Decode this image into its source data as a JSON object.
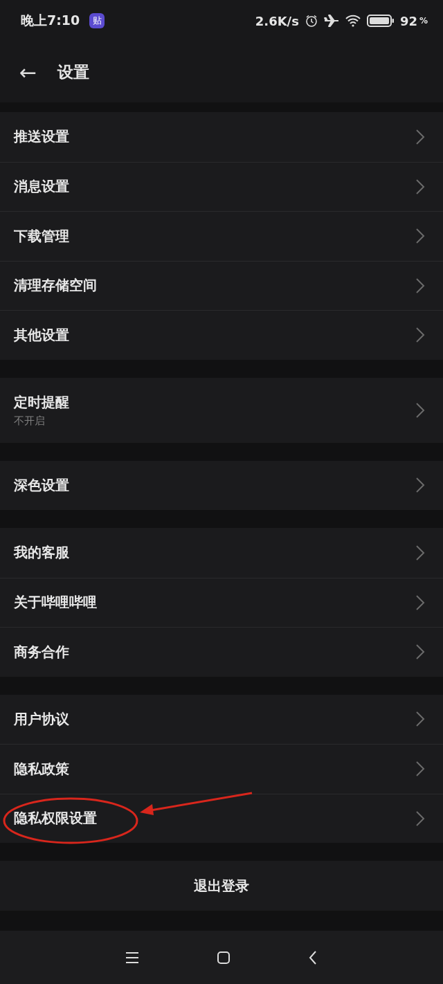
{
  "status_bar": {
    "time": "晚上7:10",
    "app_badge": "贴",
    "speed": "2.6K/s",
    "battery": "92",
    "battery_unit": "%"
  },
  "header": {
    "back": "←",
    "title": "设置"
  },
  "groups": [
    {
      "items": [
        {
          "label": "推送设置"
        },
        {
          "label": "消息设置"
        },
        {
          "label": "下载管理"
        },
        {
          "label": "清理存储空间"
        },
        {
          "label": "其他设置"
        }
      ]
    },
    {
      "items": [
        {
          "label": "定时提醒",
          "subtitle": "不开启"
        }
      ]
    },
    {
      "items": [
        {
          "label": "深色设置"
        }
      ]
    },
    {
      "items": [
        {
          "label": "我的客服"
        },
        {
          "label": "关于哔哩哔哩"
        },
        {
          "label": "商务合作"
        }
      ]
    },
    {
      "items": [
        {
          "label": "用户协议"
        },
        {
          "label": "隐私政策"
        },
        {
          "label": "隐私权限设置",
          "annotated": true
        }
      ]
    }
  ],
  "logout_button": "退出登录"
}
